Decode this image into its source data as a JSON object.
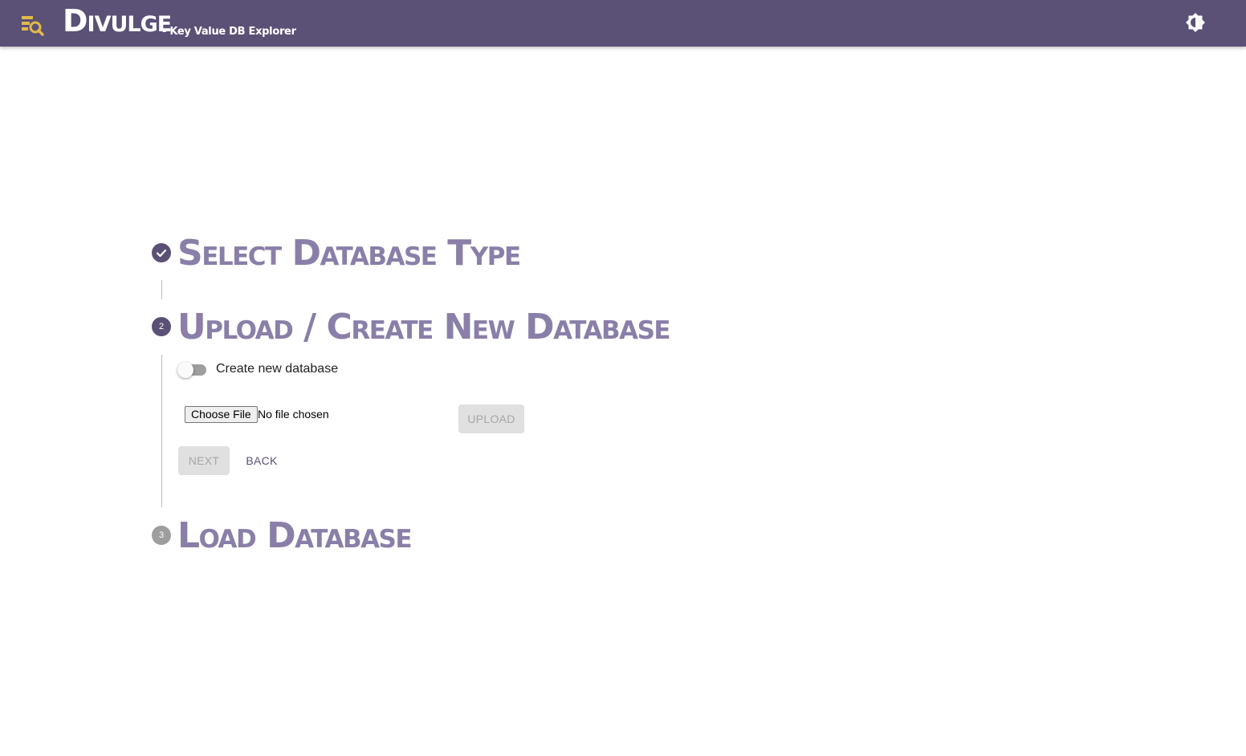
{
  "header": {
    "brand": "Divulge",
    "subtitle": "- Key Value DB Explorer",
    "logo_icon": "database-search-icon",
    "theme_icon": "brightness-icon",
    "colors": {
      "bar": "#5b5075",
      "logo": "#e2b94a"
    }
  },
  "stepper": {
    "steps": [
      {
        "number": "",
        "status": "completed",
        "icon": "check-icon",
        "title": "Select Database Type"
      },
      {
        "number": "2",
        "status": "active",
        "title": "Upload / Create New Database"
      },
      {
        "number": "3",
        "status": "pending",
        "title": "Load Database"
      }
    ],
    "active_step": {
      "toggle_label": "Create new database",
      "toggle_on": false,
      "file_button_label": "Choose File",
      "file_status": "No file chosen",
      "upload_label": "UPLOAD",
      "next_label": "NEXT",
      "back_label": "BACK"
    }
  }
}
